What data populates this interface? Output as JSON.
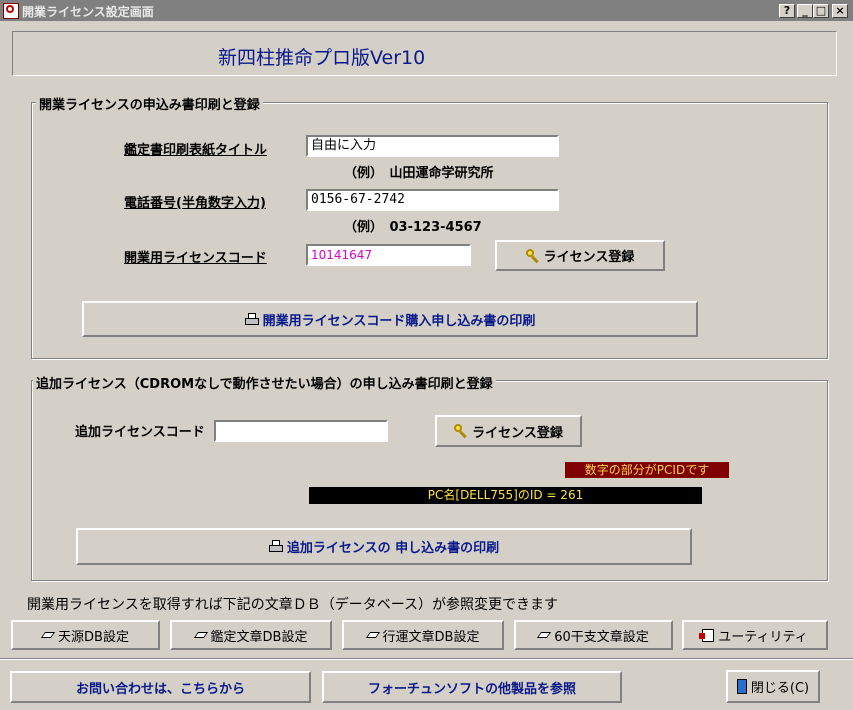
{
  "window": {
    "title": "開業ライセンス設定画面",
    "controls": [
      "?",
      "_",
      "□",
      "×"
    ]
  },
  "banner": {
    "title": "新四柱推命プロ版Ver10"
  },
  "section1": {
    "label": "開業ライセンスの申込み書印刷と登録",
    "cover_title_label": "鑑定書印刷表紙タイトル",
    "cover_title_value": "自由に入力",
    "cover_title_example": "（例）　山田運命学研究所",
    "phone_label": "電話番号(半角数字入力)",
    "phone_value": "0156-67-2742",
    "phone_example": "（例）　03-123-4567",
    "license_code_label": "開業用ライセンスコード",
    "license_code_value": "10141647",
    "register_button": "ライセンス登録",
    "print_button": "開業用ライセンスコード購入申し込み書の印刷"
  },
  "section2": {
    "label": "追加ライセンス（CDROMなしで動作させたい場合）の申し込み書印刷と登録",
    "code_label": "追加ライセンスコード",
    "code_value": "",
    "register_button": "ライセンス登録",
    "pcid_note": "数字の部分がPCIDです",
    "pc_name_line": "PC名[DELL755]のID = 261",
    "print_button": "追加ライセンスの 申し込み書の印刷"
  },
  "info_text": "開業用ライセンスを取得すれば下記の文章ＤＢ（データベース）が参照変更できます",
  "db_buttons": [
    "天源DB設定",
    "鑑定文章DB設定",
    "行運文章DB設定",
    "60干支文章設定",
    "ユーティリティ"
  ],
  "footer": {
    "contact_button": "お問い合わせは、こちらから",
    "products_button": "フォーチュンソフトの他製品を参照",
    "close_button": "閉じる(C)"
  },
  "colors": {
    "dialog_bg": "#d4d0c8",
    "banner_text": "#0a1a8c",
    "license_code_text": "#d400d4",
    "pcid_note_bg": "#800000",
    "pcid_note_text": "#ffd34a",
    "pc_line_bg": "#000000",
    "pc_line_text": "#ffe23a"
  }
}
